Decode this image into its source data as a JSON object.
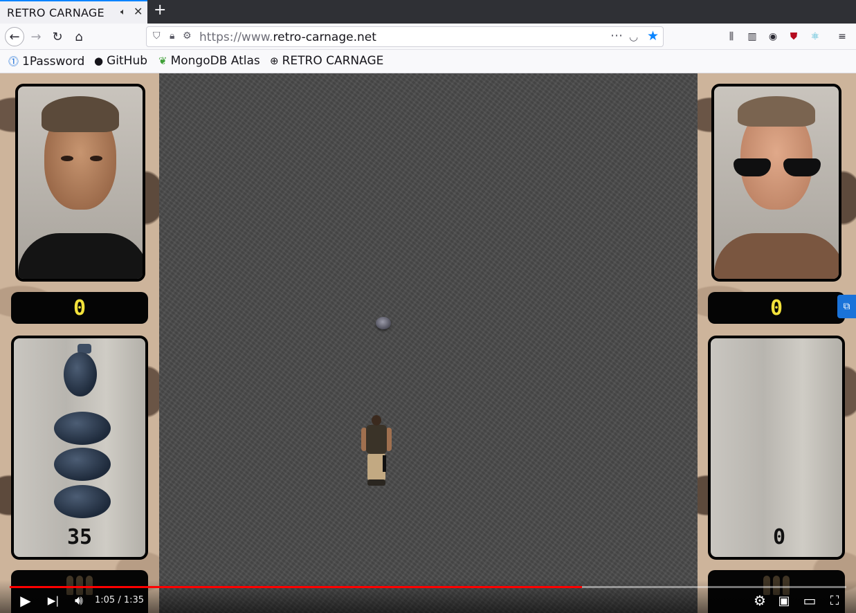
{
  "browser": {
    "tab": {
      "title": "RETRO CARNAGE"
    },
    "newtab_label": "+",
    "url": {
      "scheme": "https://www.",
      "host": "retro-carnage.net"
    },
    "bookmarks": [
      {
        "label": "1Password",
        "icon": "1password-icon"
      },
      {
        "label": "GitHub",
        "icon": "github-icon"
      },
      {
        "label": "MongoDB Atlas",
        "icon": "mongodb-leaf-icon"
      },
      {
        "label": "RETRO CARNAGE",
        "icon": "globe-icon"
      }
    ],
    "colors": {
      "accent": "#0a84ff",
      "tabbar": "#2f3035"
    }
  },
  "game": {
    "player1": {
      "score": "0",
      "ammo": "35",
      "grenades": 4
    },
    "player2": {
      "score": "0",
      "ammo": "0"
    },
    "colors": {
      "score": "#f3e23a",
      "playfield": "#4b4b4b",
      "camo": "#cdb49b"
    }
  },
  "video": {
    "time": "1:05 / 1:35",
    "progress": 0.684,
    "colors": {
      "progress": "#ff0000"
    }
  }
}
